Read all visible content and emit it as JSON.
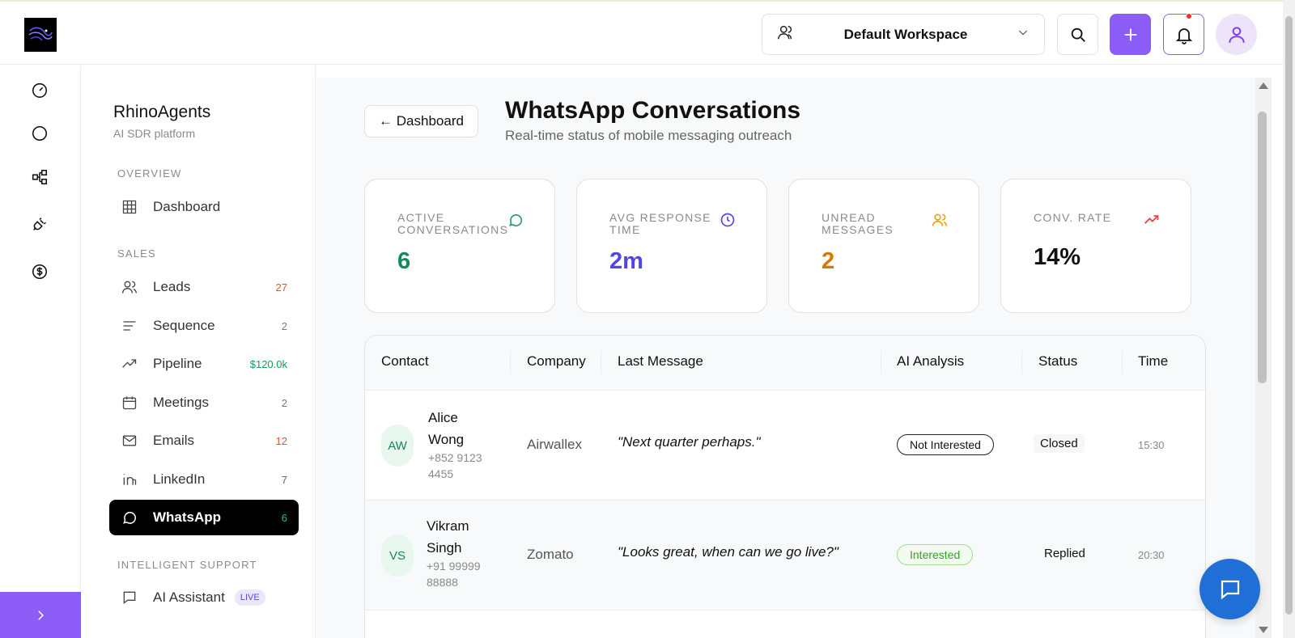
{
  "header": {
    "workspace_label": "Default Workspace"
  },
  "sidebar": {
    "brand": "RhinoAgents",
    "brand_sub": "AI SDR platform",
    "sections": {
      "overview": "OVERVIEW",
      "sales": "SALES",
      "intelligent_support": "INTELLIGENT SUPPORT"
    },
    "items": [
      {
        "label": "Dashboard",
        "count": "",
        "icon": "grid-icon"
      },
      {
        "label": "Leads",
        "count": "27",
        "icon": "users-icon",
        "count_color": "#e0541a"
      },
      {
        "label": "Sequence",
        "count": "2",
        "icon": "list-icon",
        "count_color": "#777777"
      },
      {
        "label": "Pipeline",
        "count": "$120.0k",
        "icon": "trending-up-icon",
        "count_color": "#159a5c"
      },
      {
        "label": "Meetings",
        "count": "2",
        "icon": "calendar-icon",
        "count_color": "#777777"
      },
      {
        "label": "Emails",
        "count": "12",
        "icon": "mail-icon",
        "count_color": "#e0541a"
      },
      {
        "label": "LinkedIn",
        "count": "7",
        "icon": "linkedin-icon",
        "count_color": "#3b6fb8"
      },
      {
        "label": "WhatsApp",
        "count": "6",
        "icon": "message-circle-icon",
        "count_color": "#22c55e"
      },
      {
        "label": "AI Assistant",
        "badge": "LIVE",
        "icon": "message-square-icon"
      }
    ]
  },
  "page": {
    "back_label": "← Dashboard",
    "title": "WhatsApp Conversations",
    "subtitle": "Real-time status of mobile messaging outreach"
  },
  "kpis": [
    {
      "label": "ACTIVE CONVERSATIONS",
      "value": "6",
      "color": "#168a5a",
      "icon": "message-circle-icon",
      "icon_color": "#22a06b"
    },
    {
      "label": "AVG RESPONSE TIME",
      "value": "2m",
      "color": "#4f46e5",
      "icon": "clock-icon",
      "icon_color": "#4f46e5"
    },
    {
      "label": "UNREAD MESSAGES",
      "value": "2",
      "color": "#d97706",
      "icon": "users-icon",
      "icon_color": "#f59e0b"
    },
    {
      "label": "CONV. RATE",
      "value": "14%",
      "color": "#111111",
      "icon": "trending-up-icon",
      "icon_color": "#ef4444"
    }
  ],
  "table": {
    "columns": [
      "Contact",
      "Company",
      "Last Message",
      "AI Analysis",
      "Status",
      "Time"
    ],
    "rows": [
      {
        "initials": "AW",
        "name": "Alice Wong",
        "phone": "+852 9123 4455",
        "company": "Airwallex",
        "message": "\"Next quarter perhaps.\"",
        "analysis": "Not Interested",
        "status": "Closed",
        "time": "15:30"
      },
      {
        "initials": "VS",
        "name": "Vikram Singh",
        "phone": "+91 99999 88888",
        "company": "Zomato",
        "message": "\"Looks great, when can we go live?\"",
        "analysis": "Interested",
        "status": "Replied",
        "time": "20:30"
      }
    ]
  }
}
